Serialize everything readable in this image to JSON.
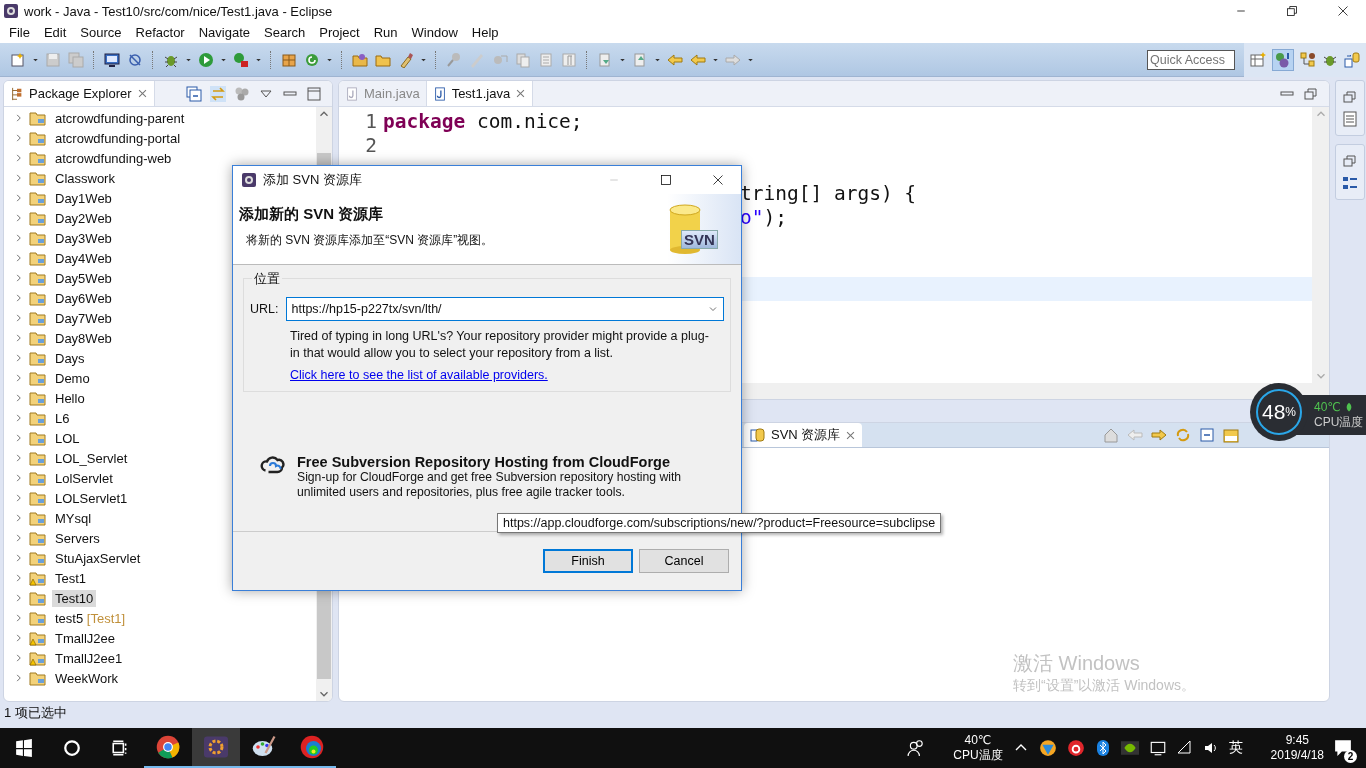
{
  "window": {
    "title": "work - Java - Test10/src/com/nice/Test1.java - Eclipse"
  },
  "menu": [
    "File",
    "Edit",
    "Source",
    "Refactor",
    "Navigate",
    "Search",
    "Project",
    "Run",
    "Window",
    "Help"
  ],
  "quick_access": {
    "placeholder": "Quick Access"
  },
  "package_explorer": {
    "title": "Package Explorer",
    "items": [
      {
        "label": "atcrowdfunding-parent",
        "selected": false,
        "warning": false
      },
      {
        "label": "atcrowdfunding-portal",
        "selected": false,
        "warning": false
      },
      {
        "label": "atcrowdfunding-web",
        "selected": false,
        "warning": false
      },
      {
        "label": "Classwork",
        "selected": false,
        "warning": false
      },
      {
        "label": "Day1Web",
        "selected": false,
        "warning": false
      },
      {
        "label": "Day2Web",
        "selected": false,
        "warning": false
      },
      {
        "label": "Day3Web",
        "selected": false,
        "warning": false
      },
      {
        "label": "Day4Web",
        "selected": false,
        "warning": false
      },
      {
        "label": "Day5Web",
        "selected": false,
        "warning": false
      },
      {
        "label": "Day6Web",
        "selected": false,
        "warning": false
      },
      {
        "label": "Day7Web",
        "selected": false,
        "warning": false
      },
      {
        "label": "Day8Web",
        "selected": false,
        "warning": false
      },
      {
        "label": "Days",
        "selected": false,
        "warning": false
      },
      {
        "label": "Demo",
        "selected": false,
        "warning": false
      },
      {
        "label": "Hello",
        "selected": false,
        "warning": false
      },
      {
        "label": "L6",
        "selected": false,
        "warning": false
      },
      {
        "label": "LOL",
        "selected": false,
        "warning": false
      },
      {
        "label": "LOL_Servlet",
        "selected": false,
        "warning": false
      },
      {
        "label": "LolServlet",
        "selected": false,
        "warning": false
      },
      {
        "label": "LOLServlet1",
        "selected": false,
        "warning": false
      },
      {
        "label": "MYsql",
        "selected": false,
        "warning": false
      },
      {
        "label": "Servers",
        "selected": false,
        "warning": false
      },
      {
        "label": "StuAjaxServlet",
        "selected": false,
        "warning": false
      },
      {
        "label": "Test1",
        "selected": false,
        "warning": true
      },
      {
        "label": "Test10",
        "selected": true,
        "warning": false
      },
      {
        "label": "test5",
        "decoration": "[Test1]",
        "selected": false,
        "warning": false
      },
      {
        "label": "TmallJ2ee",
        "selected": false,
        "warning": true
      },
      {
        "label": "TmallJ2ee1",
        "selected": false,
        "warning": true
      },
      {
        "label": "WeekWork",
        "selected": false,
        "warning": false
      }
    ]
  },
  "editor": {
    "tabs": [
      {
        "label": "Main.java",
        "selected": false
      },
      {
        "label": "Test1.java",
        "selected": true
      }
    ],
    "lines": [
      {
        "number": "1",
        "current": false,
        "code": [
          {
            "text": "package",
            "kind": "keyword"
          },
          {
            "text": " com.nice;",
            "kind": "plain"
          }
        ]
      },
      {
        "number": "2",
        "current": false
      },
      {
        "current": false
      },
      {
        "current": false,
        "tail": [
          {
            "text": "tring[] args) {",
            "kind": "plain"
          }
        ]
      },
      {
        "current": false,
        "tail": [
          {
            "text": "o\"",
            "kind": "string"
          },
          {
            "text": ");",
            "kind": "plain"
          }
        ]
      },
      {
        "current": false
      },
      {
        "current": false
      },
      {
        "current": true
      }
    ]
  },
  "svn_view": {
    "tab": "SVN 资源库"
  },
  "activation": {
    "title": "激活 Windows",
    "text": "转到“设置”以激活 Windows。"
  },
  "status_bar": "1 项已选中",
  "dialog": {
    "title": "添加 SVN 资源库",
    "heading": "添加新的 SVN 资源库",
    "description": "将新的 SVN 资源库添加至“SVN 资源库”视图。",
    "logo": "SVN",
    "group": "位置",
    "url_label": "URL:",
    "url": "https://hp15-p227tx/svn/lth/",
    "help": "Tired of typing in long URL's?  Your repository provider might provide a plug-in that would allow you to select your repository from a list.",
    "link": "Click here to see the list of available providers.",
    "promo_title": "Free Subversion Repository Hosting from CloudForge",
    "promo_text": "Sign-up for CloudForge and get free Subversion repository hosting with unlimited users and repositories, plus free agile tracker tools.",
    "buttons": [
      {
        "label": "Finish",
        "default": true
      },
      {
        "label": "Cancel",
        "default": false
      }
    ]
  },
  "tooltip": "https://app.cloudforge.com/subscriptions/new/?product=Freesource=subclipse",
  "cpu_widget": {
    "usage": "48",
    "unit": "%",
    "temp": "40℃",
    "label": "CPU温度"
  },
  "taskbar": {
    "apps": [
      {
        "kind": "chrome",
        "active": false
      },
      {
        "kind": "ide",
        "active": true
      },
      {
        "kind": "paint",
        "active": false
      },
      {
        "kind": "rings",
        "active": false
      }
    ],
    "temp": "40℃",
    "temp_label": "CPU温度",
    "ime": "英",
    "time": "9:45",
    "date": "2019/4/18",
    "notifications": "2"
  }
}
